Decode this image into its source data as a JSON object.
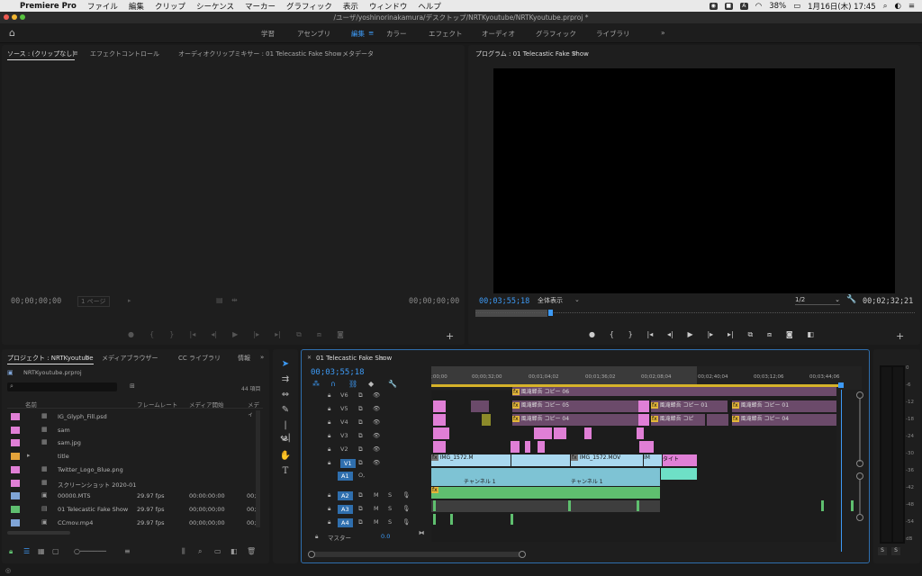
{
  "menubar": {
    "app_name": "Premiere Pro",
    "items": [
      "ファイル",
      "編集",
      "クリップ",
      "シーケンス",
      "マーカー",
      "グラフィック",
      "表示",
      "ウィンドウ",
      "ヘルプ"
    ],
    "battery": "38%",
    "clock": "1月16日(木)  17:45",
    "input_mode": "A"
  },
  "title": "/ユーザ/yoshinorinakamura/デスクトップ/NRTKyoutube/NRTKyoutube.prproj *",
  "workspaces": {
    "items": [
      "学習",
      "アセンブリ",
      "編集",
      "カラー",
      "エフェクト",
      "オーディオ",
      "グラフィック",
      "ライブラリ"
    ],
    "active": "編集",
    "more": "»"
  },
  "source_panel": {
    "tabs": [
      "ソース : (クリップなし)",
      "エフェクトコントロール",
      "オーディオクリップミキサー : 01 Telecastic Fake Show",
      "メタデータ"
    ],
    "timecode_left": "00;00;00;00",
    "page": "1 ページ",
    "timecode_right": "00;00;00;00"
  },
  "program_panel": {
    "title": "プログラム : 01 Telecastic Fake Show",
    "timecode": "00;03;55;18",
    "zoom": "全体表示",
    "resolution": "1/2",
    "duration": "00;02;32;21"
  },
  "project_panel": {
    "tabs": [
      "プロジェクト : NRTKyoutube",
      "メディアブラウザー",
      "CC ライブラリ",
      "情報"
    ],
    "file": "NRTKyoutube.prproj",
    "count": "44 項目",
    "columns": [
      "名前",
      "フレームレート",
      "メディア開始",
      "メディ"
    ],
    "rows": [
      {
        "name": "IG_Glyph_Fill.psd",
        "fps": "",
        "start": "",
        "color": "#e07fd6"
      },
      {
        "name": "sam",
        "fps": "",
        "start": "",
        "color": "#e07fd6"
      },
      {
        "name": "sam.jpg",
        "fps": "",
        "start": "",
        "color": "#e07fd6"
      },
      {
        "name": "title",
        "fps": "",
        "start": "",
        "color": "#e3a23a"
      },
      {
        "name": "Twitter_Logo_Blue.png",
        "fps": "",
        "start": "",
        "color": "#e07fd6"
      },
      {
        "name": "スクリーンショット 2020-01",
        "fps": "",
        "start": "",
        "color": "#e07fd6"
      },
      {
        "name": "00000.MTS",
        "fps": "29.97 fps",
        "start": "00:00:00:00",
        "color": "#7fa4d6"
      },
      {
        "name": "01 Telecastic Fake Show",
        "fps": "29.97 fps",
        "start": "00;00;00;00",
        "color": "#5fbf6f"
      },
      {
        "name": "CCmov.mp4",
        "fps": "29.97 fps",
        "start": "00;00;00;00",
        "color": "#7fa4d6"
      }
    ],
    "last_col_values": [
      "00;0",
      "00;2",
      "00;0"
    ]
  },
  "timeline": {
    "tab": "01 Telecastic Fake Show",
    "timecode": "00;03;55;18",
    "ruler": [
      ";00;00",
      "00;00;32;00",
      "00;01;04;02",
      "00;01;36;02",
      "00;02;08;04",
      "00;02;40;04",
      "00;03;12;06",
      "00;03;44;06"
    ],
    "video_tracks": [
      "V6",
      "V5",
      "V4",
      "V3",
      "V2",
      "V1"
    ],
    "audio_tracks": [
      "A1",
      "A2",
      "A3",
      "A4"
    ],
    "master": "マスター",
    "master_value": "0.0",
    "a1_sub": "O,",
    "clip_labels": {
      "v6": "風滝蝉吾 コピー 06",
      "v5a": "風滝蝉吾 コピー 05",
      "v5b": "風滝蝉吾 コピー 01",
      "v5c": "風滝蝉吾 コピー 01",
      "v4a": "風滝蝉吾 コピー 04",
      "v4b": "風滝蝉吾 コピ",
      "v4c": "風滝蝉吾 コピー 04",
      "v1a": "IMG_1572.M",
      "v1b": "IMG_1572.MOV",
      "v1c": "IM",
      "v1d": "タイト",
      "a1a": "チャンネル 1",
      "a1b": "チャンネル 1"
    }
  },
  "meter_scale": [
    "0",
    "-6",
    "-12",
    "-18",
    "-24",
    "-30",
    "-36",
    "-42",
    "-48",
    "-54",
    "dB"
  ],
  "meter_solo": [
    "S",
    "S"
  ]
}
